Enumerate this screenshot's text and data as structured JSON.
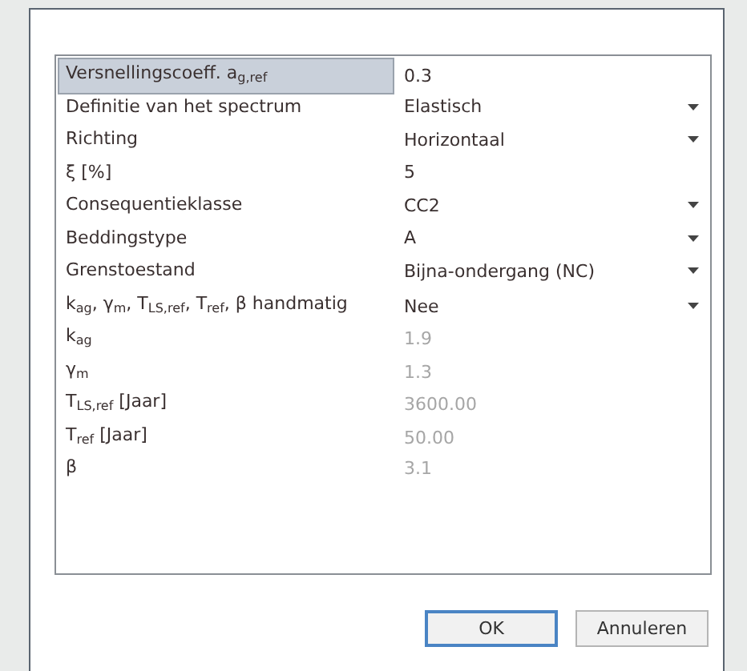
{
  "properties": [
    {
      "label": "Versnellingscoeff. a$_{g,ref}$",
      "value": "0.3",
      "kind": "text",
      "selected": true,
      "disabled": false
    },
    {
      "label": "Definitie van het spectrum",
      "value": "Elastisch",
      "kind": "dropdown",
      "selected": false,
      "disabled": false
    },
    {
      "label": "Richting",
      "value": "Horizontaal",
      "kind": "dropdown",
      "selected": false,
      "disabled": false
    },
    {
      "label": "ξ [%]",
      "value": "5",
      "kind": "text",
      "selected": false,
      "disabled": false
    },
    {
      "label": "Consequentieklasse",
      "value": "CC2",
      "kind": "dropdown",
      "selected": false,
      "disabled": false
    },
    {
      "label": "Beddingstype",
      "value": "A",
      "kind": "dropdown",
      "selected": false,
      "disabled": false
    },
    {
      "label": "Grenstoestand",
      "value": "Bijna-ondergang (NC)",
      "kind": "dropdown",
      "selected": false,
      "disabled": false
    },
    {
      "label": "k$_{ag}$, γ$_{m}$, T$_{LS,ref}$, T$_{ref}$, β handmatig",
      "value": "Nee",
      "kind": "dropdown",
      "selected": false,
      "disabled": false
    },
    {
      "label": "k$_{ag}$",
      "value": "1.9",
      "kind": "text",
      "selected": false,
      "disabled": true
    },
    {
      "label": "γ$_{m}$",
      "value": "1.3",
      "kind": "text",
      "selected": false,
      "disabled": true
    },
    {
      "label": "T$_{LS,ref}$ [Jaar]",
      "value": "3600.00",
      "kind": "text",
      "selected": false,
      "disabled": true
    },
    {
      "label": "T$_{ref}$ [Jaar]",
      "value": "50.00",
      "kind": "text",
      "selected": false,
      "disabled": true
    },
    {
      "label": "β",
      "value": "3.1",
      "kind": "text",
      "selected": false,
      "disabled": true
    }
  ],
  "buttons": [
    {
      "label": "OK",
      "default": true
    },
    {
      "label": "Annuleren",
      "default": false
    }
  ]
}
